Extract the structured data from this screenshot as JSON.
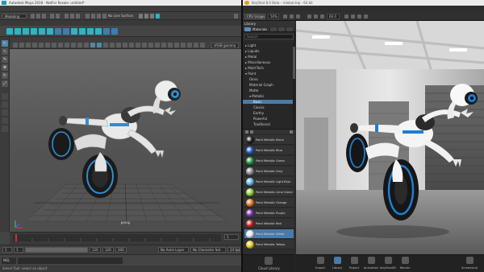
{
  "maya": {
    "title": "Autodesk Maya 2018 - NotFor Resale: untitled*",
    "window_controls": [
      "—",
      "☐",
      "✕"
    ],
    "menu": [
      "File",
      "Edit",
      "Create",
      "Select",
      "Modify",
      "Display",
      "Windows",
      "Mesh",
      "Edit Mesh",
      "Mesh Tools",
      "Mesh Display",
      "Curves",
      "Surfaces",
      "Deform",
      "UV",
      "Generate",
      "Cache",
      "Arnold",
      "Help"
    ],
    "mode": "Modeling",
    "live_surface": "No Live Surface",
    "shelf_tabs": [
      "Curves / Surfaces",
      "Poly Modeling",
      "Sculpting",
      "Rigging",
      "Animation",
      "Rendering",
      "FX",
      "FX Caching",
      "Custom",
      "Arnold",
      "MASH"
    ],
    "active_shelf_tab": "MASH",
    "panel_menu": [
      "View",
      "Shading",
      "Lighting",
      "Show",
      "Renderer",
      "Panels"
    ],
    "color_space": "sRGB gamma",
    "camera_label": "persp",
    "frame_start": "1",
    "frame_end": "120",
    "range_start": "1",
    "range_end": "120",
    "range_out": "200",
    "anim_layer": "No Anim Layer",
    "char_set": "No Character Set",
    "fps": "24 fps",
    "current_frame": "1",
    "mel_label": "MEL",
    "help_line": "Select Tool: select an object",
    "colors": {
      "accent": "#5285a6",
      "shelf_arnold": "#2bb5c5"
    }
  },
  "keyshot": {
    "title": "KeyShot 8.0 Beta - ridebot.bip - 64 bit",
    "window_controls": [
      "—",
      "☐",
      "✕"
    ],
    "menu": [
      "File",
      "Edit",
      "Environment",
      "Lighting",
      "Camera",
      "Image",
      "Render",
      "View",
      "Window",
      "Help"
    ],
    "cpu_usage_label": "CPU Usage",
    "cpu_usage_value": "50%",
    "render_value": "60.0",
    "library": {
      "header": "Library",
      "active_tab": "Materials",
      "search_placeholder": "Search",
      "tree": [
        {
          "label": "▸ Light",
          "indent": 0
        },
        {
          "label": "▸ Liquids",
          "indent": 0
        },
        {
          "label": "▸ Metal",
          "indent": 0
        },
        {
          "label": "▸ Miscellaneous",
          "indent": 0
        },
        {
          "label": "▸ Mold-Tech",
          "indent": 0
        },
        {
          "label": "▾ Paint",
          "indent": 0
        },
        {
          "label": "Gloss",
          "indent": 1
        },
        {
          "label": "Material Graph",
          "indent": 1
        },
        {
          "label": "Matte",
          "indent": 1
        },
        {
          "label": "▾ Metallic",
          "indent": 1
        },
        {
          "label": "Basic",
          "indent": 2,
          "selected": true
        },
        {
          "label": "Classic",
          "indent": 2
        },
        {
          "label": "Earthy",
          "indent": 2
        },
        {
          "label": "Powerful",
          "indent": 2
        },
        {
          "label": "Traditional",
          "indent": 2
        }
      ],
      "swatches": [
        {
          "label": "Paint Metallic Black",
          "color": "#1a1a1a"
        },
        {
          "label": "Paint Metallic Blue",
          "color": "#1f56c8"
        },
        {
          "label": "Paint Metallic Green",
          "color": "#1f9a3a"
        },
        {
          "label": "Paint Metallic Grey",
          "color": "#8a8a8a"
        },
        {
          "label": "Paint Metallic Light Blue",
          "color": "#5fb8e8"
        },
        {
          "label": "Paint Metallic Lime Green",
          "color": "#8ad132"
        },
        {
          "label": "Paint Metallic Orange",
          "color": "#e8761f"
        },
        {
          "label": "Paint Metallic Purple",
          "color": "#7a2fb8"
        },
        {
          "label": "Paint Metallic Red",
          "color": "#c81f1f"
        },
        {
          "label": "Paint Metallic White",
          "color": "#e6e6e6",
          "selected": true
        },
        {
          "label": "Paint Metallic Yellow",
          "color": "#e8c81f"
        }
      ],
      "cloud_library": "Cloud Library"
    },
    "bottom_buttons": [
      "Import",
      "Library",
      "Project",
      "Animation",
      "KeyShotXR",
      "Render",
      "Screenshot"
    ],
    "active_bottom_button": "Library",
    "colors": {
      "accent": "#4a7aa8",
      "logo": "#e39c1f"
    }
  }
}
